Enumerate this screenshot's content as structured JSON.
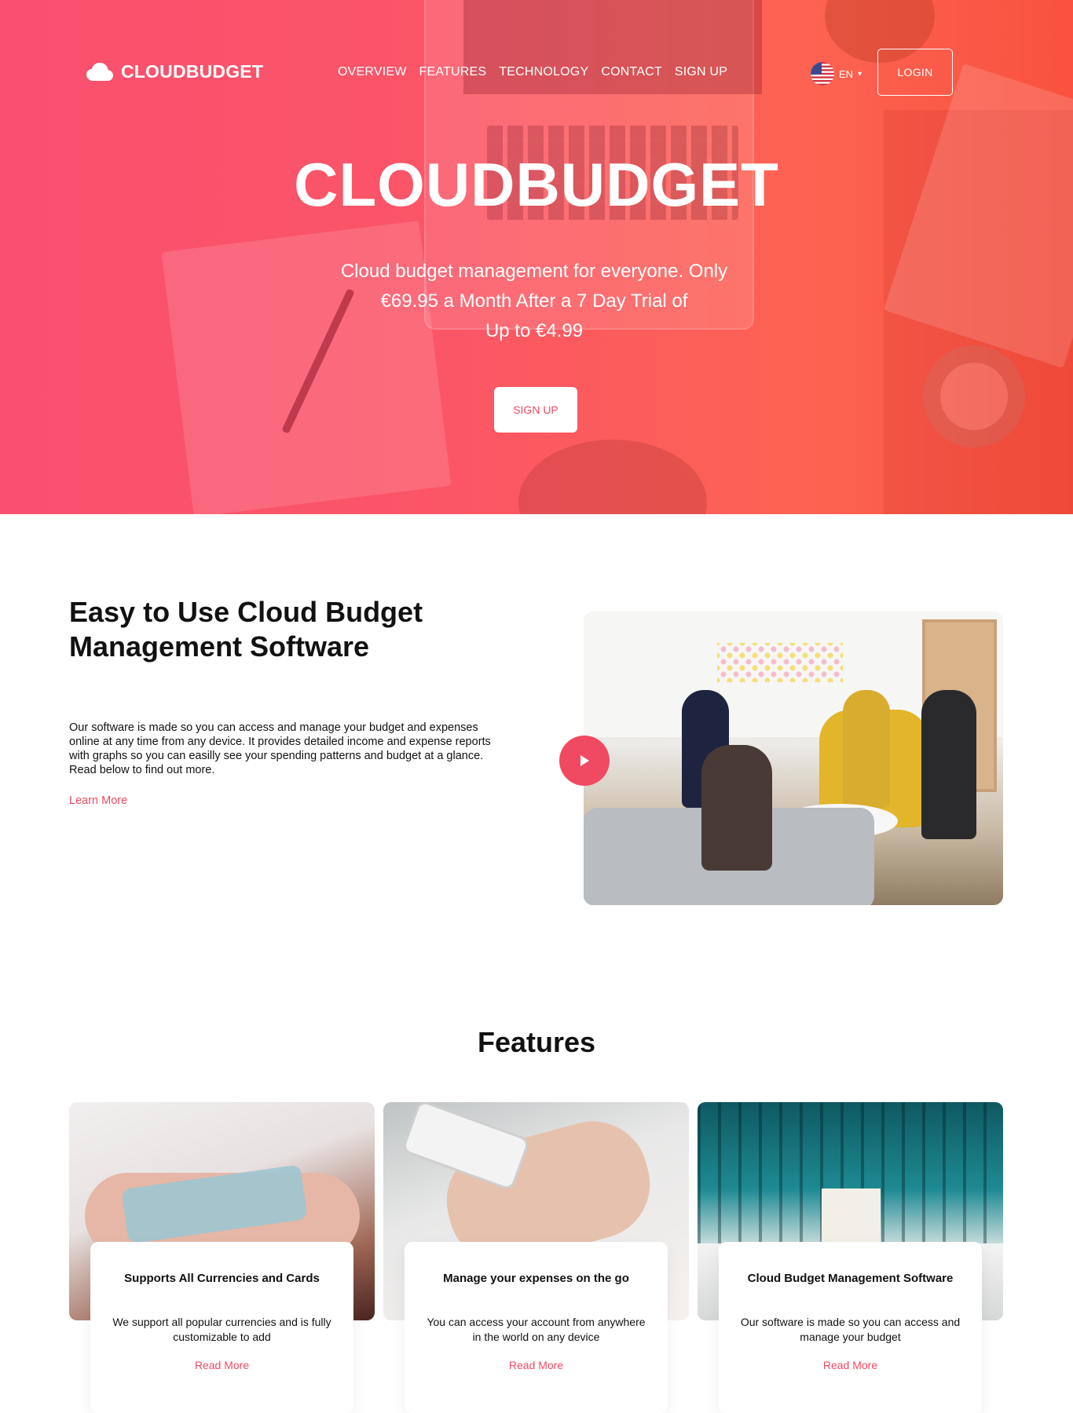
{
  "header": {
    "brand": "CLOUDBUDGET",
    "nav": [
      "OVERVIEW",
      "FEATURES",
      "TECHNOLOGY",
      "CONTACT",
      "SIGN UP"
    ],
    "language": "EN",
    "language_caret": "▾",
    "login_label": "LOGIN"
  },
  "hero": {
    "title": "CLOUDBUDGET",
    "subtitle_line1": "Cloud budget management for everyone. Only",
    "subtitle_line2": "€69.95 a Month After a 7 Day Trial of",
    "subtitle_line3": "Up to €4.99",
    "signup_label": "SIGN UP"
  },
  "about": {
    "title_line1": "Easy to Use Cloud Budget",
    "title_line2": "Management Software",
    "text": "Our software is made so you can access and manage your budget and expenses online at any time from any device. It provides detailed income and expense reports with graphs so you can easilly see your spending patterns and budget at a glance. Read below to find out more.",
    "link": "Learn More"
  },
  "features": {
    "title": "Features",
    "cards": [
      {
        "title": "Supports All Currencies and Cards",
        "text": "We support all popular currencies and is fully customizable to add",
        "link": "Read More"
      },
      {
        "title": "Manage your expenses on the go",
        "text": "You can access your account from anywhere in the world on any device",
        "link": "Read More"
      },
      {
        "title": "Cloud Budget Management Software",
        "text": "Our software is made so you can access and manage your budget",
        "link": "Read More"
      }
    ]
  },
  "colors": {
    "accent": "#f04a62",
    "hero_gradient_start": "#f9506f",
    "hero_gradient_end": "#f9523f"
  },
  "icons": {
    "logo": "cloud-icon",
    "language": "us-flag-icon",
    "video": "play-icon"
  }
}
